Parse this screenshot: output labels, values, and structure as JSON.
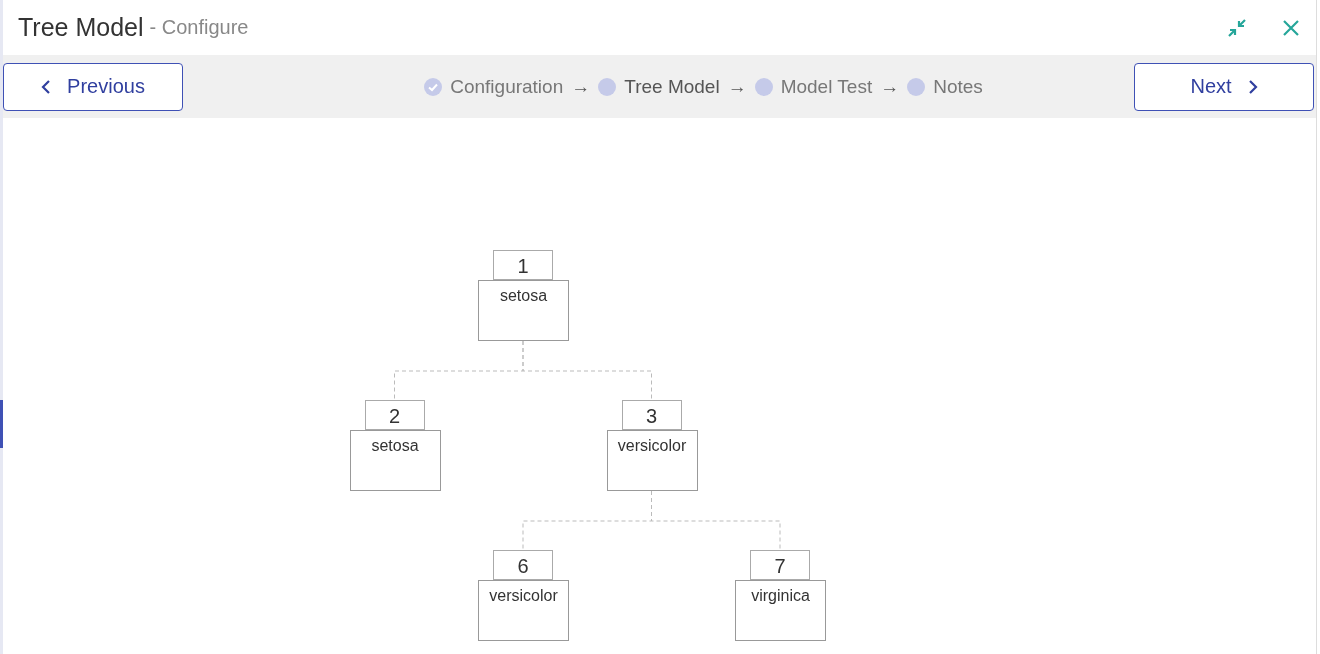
{
  "window": {
    "title": "Tree Model",
    "subtitle": "- Configure"
  },
  "nav": {
    "previous": "Previous",
    "next": "Next"
  },
  "steps": [
    {
      "label": "Configuration",
      "done": true,
      "selected": false
    },
    {
      "label": "Tree Model",
      "done": false,
      "selected": true
    },
    {
      "label": "Model Test",
      "done": false,
      "selected": false
    },
    {
      "label": "Notes",
      "done": false,
      "selected": false
    }
  ],
  "step_separator": "→",
  "tree": {
    "id": "1",
    "label": "setosa",
    "children": [
      {
        "id": "2",
        "label": "setosa"
      },
      {
        "id": "3",
        "label": "versicolor",
        "children": [
          {
            "id": "6",
            "label": "versicolor"
          },
          {
            "id": "7",
            "label": "virginica"
          }
        ]
      }
    ]
  }
}
